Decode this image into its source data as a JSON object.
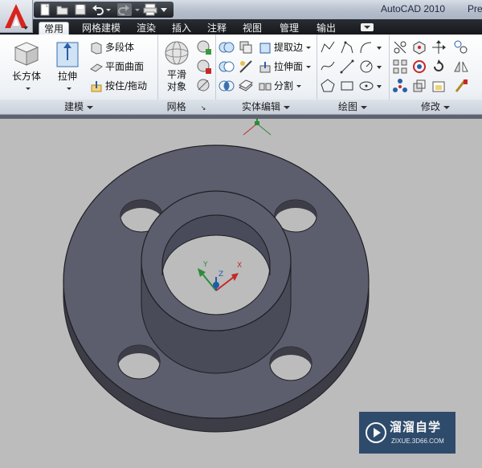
{
  "title": {
    "app": "AutoCAD 2010",
    "extra": "Pre"
  },
  "quick_access": [
    "new-icon",
    "open-icon",
    "save-icon",
    "undo-icon",
    "redo-icon",
    "plot-icon",
    "dropdown-icon"
  ],
  "tabs": [
    {
      "label": "常用",
      "active": true
    },
    {
      "label": "网格建模"
    },
    {
      "label": "渲染"
    },
    {
      "label": "插入"
    },
    {
      "label": "注释"
    },
    {
      "label": "视图"
    },
    {
      "label": "管理"
    },
    {
      "label": "输出"
    }
  ],
  "panels": {
    "modeling": {
      "footer": "建模",
      "box_label": "长方体",
      "extrude_label": "拉伸",
      "polysolid_label": "多段体",
      "planar_label": "平面曲面",
      "presspull_label": "按住/拖动"
    },
    "mesh": {
      "footer": "网格",
      "smooth_label_1": "平滑",
      "smooth_label_2": "对象"
    },
    "solid_editing": {
      "footer": "实体编辑",
      "extract_label": "提取边",
      "extrude_face_label": "拉伸面",
      "separate_label": "分割"
    },
    "draw": {
      "footer": "绘图"
    },
    "modify": {
      "footer": "修改"
    }
  },
  "ucs": {
    "x": "X",
    "y": "Y",
    "z": "Z"
  },
  "watermark": {
    "title": "溜溜自学",
    "sub": "ZIXUE.3D66.COM"
  },
  "colors": {
    "ribbon_tab_bg": "#1f2126",
    "viewport": "#bcbcbc",
    "model_fill": "#5c5e6e"
  }
}
